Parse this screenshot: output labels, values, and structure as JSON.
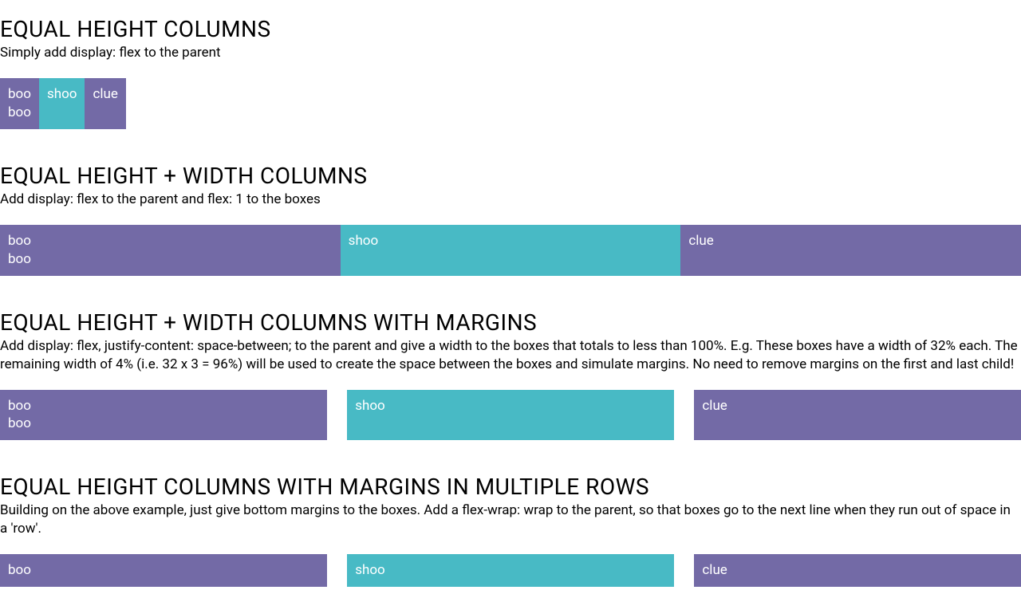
{
  "sections": [
    {
      "heading": "EQUAL HEIGHT COLUMNS",
      "desc": "Simply add display: flex to the parent",
      "boxes": [
        {
          "text": "boo\nboo"
        },
        {
          "text": "shoo"
        },
        {
          "text": "clue"
        }
      ]
    },
    {
      "heading": "EQUAL HEIGHT + WIDTH COLUMNS",
      "desc": "Add display: flex to the parent and flex: 1 to the boxes",
      "boxes": [
        {
          "text": "boo\nboo"
        },
        {
          "text": "shoo"
        },
        {
          "text": "clue"
        }
      ]
    },
    {
      "heading": "EQUAL HEIGHT + WIDTH COLUMNS WITH MARGINS",
      "desc": "Add display: flex, justify-content: space-between; to the parent and give a width to the boxes that totals to less than 100%. E.g. These boxes have a width of 32% each. The remaining width of 4% (i.e. 32 x 3 = 96%) will be used to create the space between the boxes and simulate margins. No need to remove margins on the first and last child!",
      "boxes": [
        {
          "text": "boo\nboo"
        },
        {
          "text": "shoo"
        },
        {
          "text": "clue"
        }
      ]
    },
    {
      "heading": "EQUAL HEIGHT COLUMNS WITH MARGINS IN MULTIPLE ROWS",
      "desc": "Building on the above example, just give bottom margins to the boxes. Add a flex-wrap: wrap to the parent, so that boxes go to the next line when they run out of space in a 'row'.",
      "boxes": [
        {
          "text": "boo"
        },
        {
          "text": "shoo"
        },
        {
          "text": "clue"
        }
      ]
    }
  ],
  "colors": {
    "purple": "#736AA6",
    "teal": "#48BAC5"
  }
}
